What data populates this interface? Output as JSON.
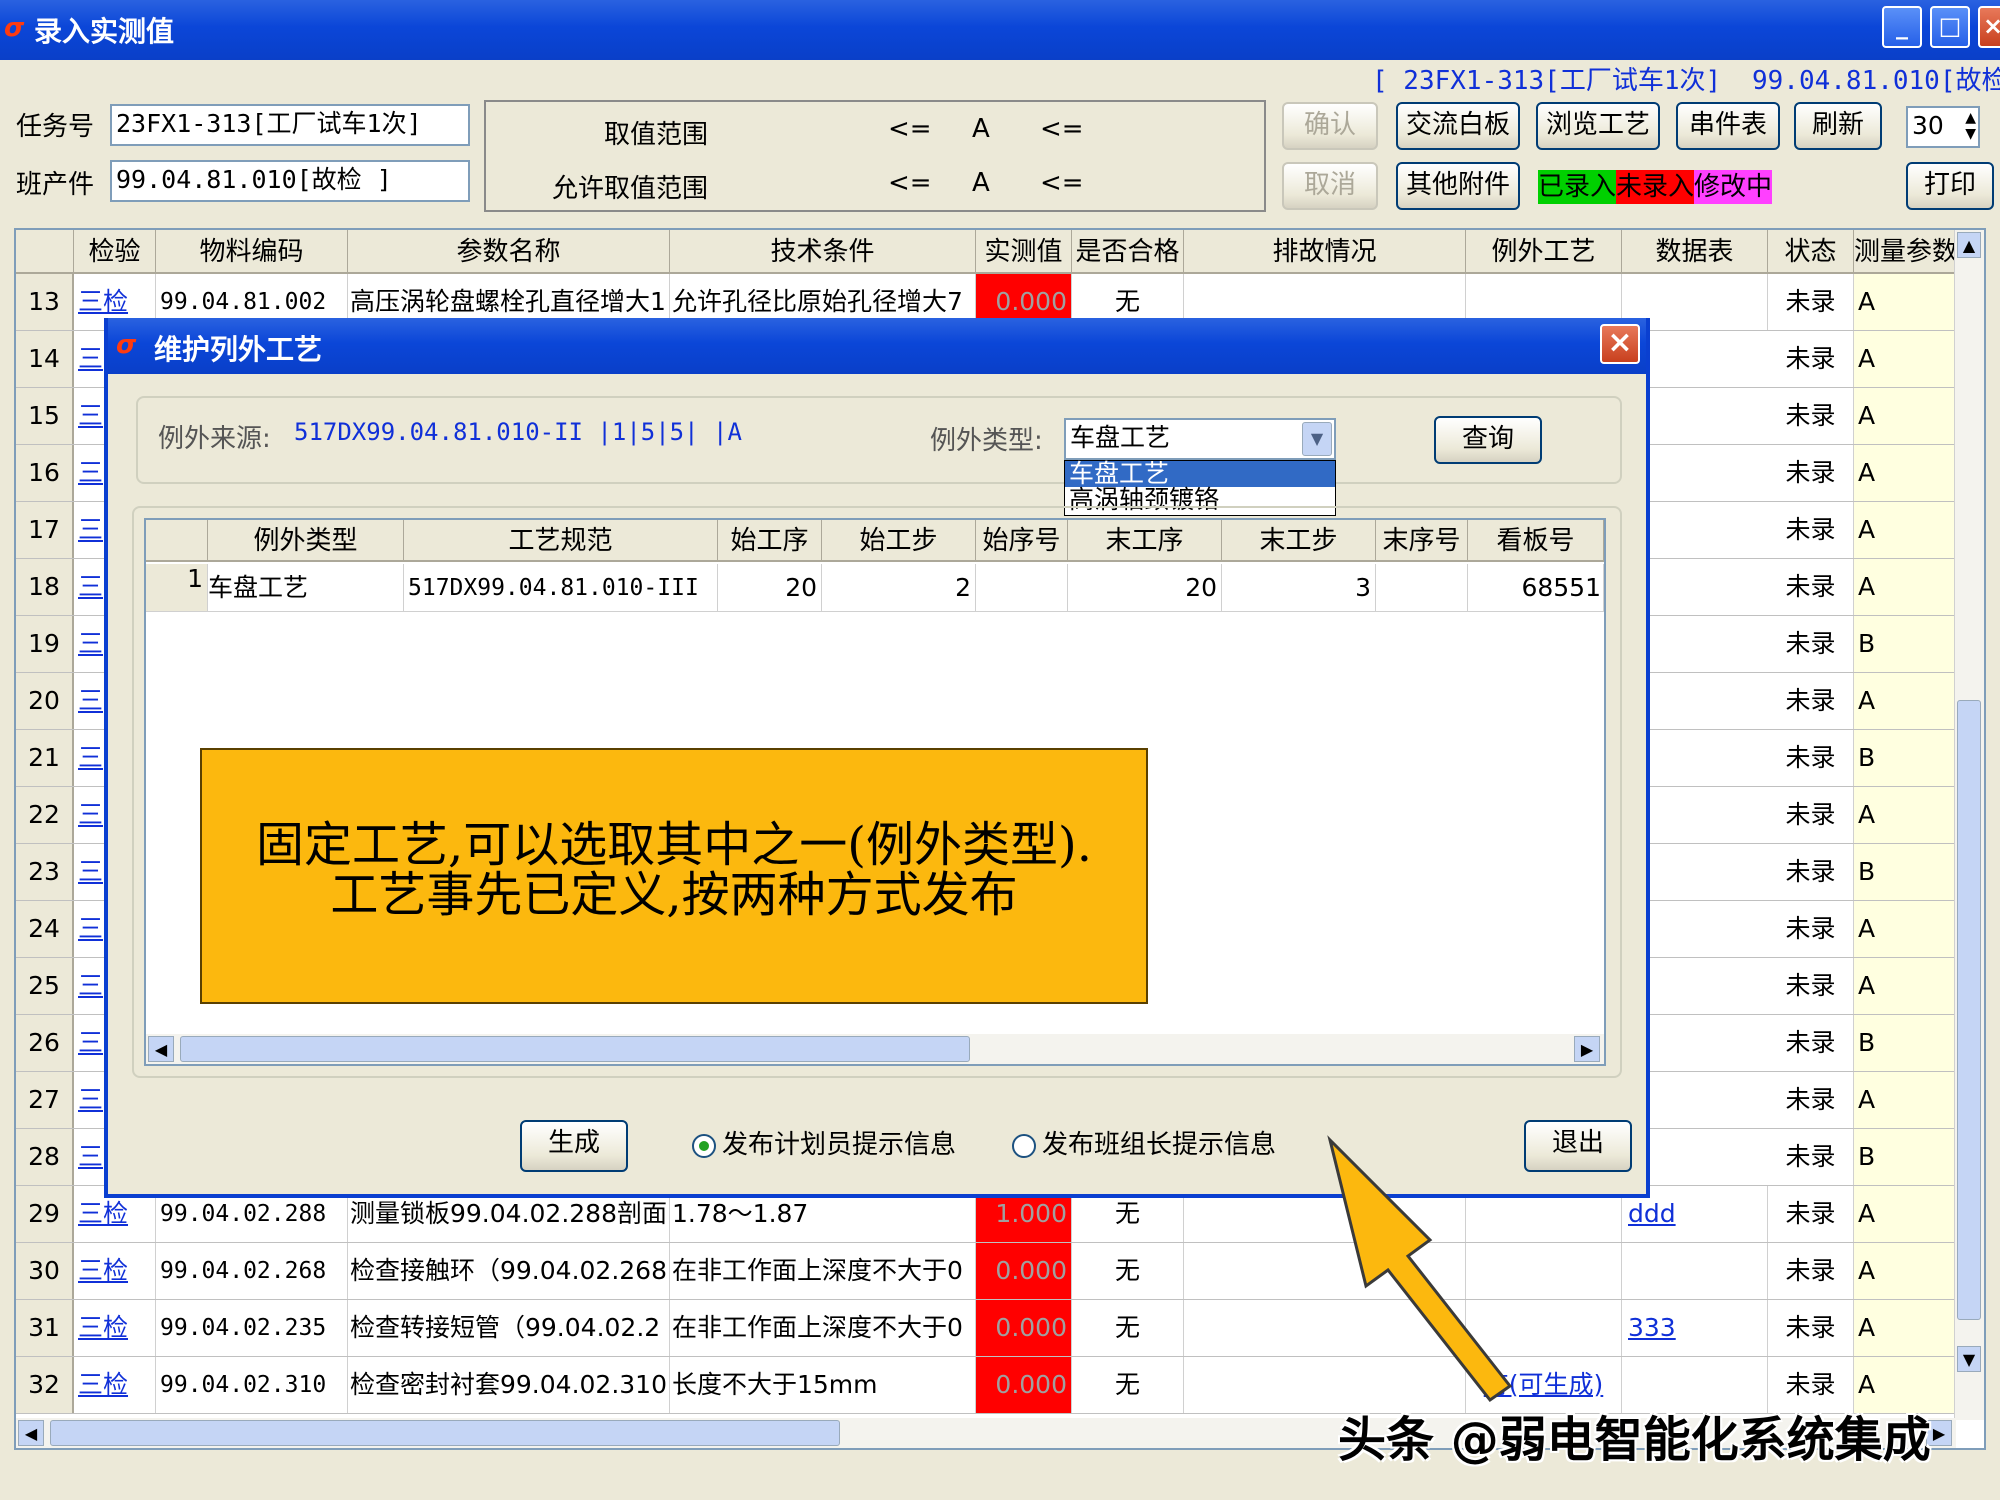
{
  "window": {
    "title": "录入实测值"
  },
  "header_info": {
    "task_ref": "[ 23FX1-313[工厂试车1次]",
    "part_ref": "99.04.81.010[故检"
  },
  "task": {
    "label": "任务号",
    "value": "23FX1-313[工厂试车1次]"
  },
  "part": {
    "label": "班产件",
    "value": "99.04.81.010[故检 ]"
  },
  "range": {
    "label1": "取值范围",
    "label2": "允许取值范围",
    "le": "<=",
    "a": "A"
  },
  "buttons": {
    "confirm": "确认",
    "cancel": "取消",
    "whiteboard": "交流白板",
    "browse": "浏览工艺",
    "parts_list": "串件表",
    "refresh": "刷新",
    "attachments": "其他附件",
    "print": "打印"
  },
  "page_size": "30",
  "legend": {
    "entered": "已录入",
    "not_entered": "未录入",
    "modifying": "修改中",
    "entered_color": "#00d000",
    "not_entered_color": "#ff0000",
    "modifying_color": "#ff40ff"
  },
  "grid": {
    "headers": [
      "检验",
      "物料编码",
      "参数名称",
      "技术条件",
      "实测值",
      "是否合格",
      "排故情况",
      "例外工艺",
      "数据表",
      "状态",
      "测量参数"
    ],
    "rows": [
      {
        "no": "13",
        "check": "三检",
        "code": "99.04.81.002",
        "name": "高压涡轮盘螺栓孔直径增大1",
        "cond": "允许孔径比原始孔径增大7",
        "value": "0.000",
        "ok": "无",
        "exc": "",
        "table": "",
        "status": "未录",
        "param": "A"
      },
      {
        "no": "14",
        "check": "三",
        "status": "未录",
        "param": "A"
      },
      {
        "no": "15",
        "check": "三",
        "status": "未录",
        "param": "A"
      },
      {
        "no": "16",
        "check": "三",
        "status": "未录",
        "param": "A"
      },
      {
        "no": "17",
        "check": "三",
        "status": "未录",
        "param": "A"
      },
      {
        "no": "18",
        "check": "三",
        "status": "未录",
        "param": "A"
      },
      {
        "no": "19",
        "check": "三",
        "status": "未录",
        "param": "B"
      },
      {
        "no": "20",
        "check": "三",
        "status": "未录",
        "param": "A"
      },
      {
        "no": "21",
        "check": "三",
        "status": "未录",
        "param": "B"
      },
      {
        "no": "22",
        "check": "三",
        "status": "未录",
        "param": "A"
      },
      {
        "no": "23",
        "check": "三",
        "status": "未录",
        "param": "B"
      },
      {
        "no": "24",
        "check": "三",
        "status": "未录",
        "param": "A"
      },
      {
        "no": "25",
        "check": "三",
        "status": "未录",
        "param": "A"
      },
      {
        "no": "26",
        "check": "三",
        "status": "未录",
        "param": "B"
      },
      {
        "no": "27",
        "check": "三",
        "status": "未录",
        "param": "A"
      },
      {
        "no": "28",
        "check": "三",
        "status": "未录",
        "param": "B"
      },
      {
        "no": "29",
        "check": "三检",
        "code": "99.04.02.288",
        "name": "测量锁板99.04.02.288剖面",
        "cond": "1.78～1.87",
        "value": "1.000",
        "ok": "无",
        "exc": "",
        "table": "ddd",
        "status": "未录",
        "param": "A"
      },
      {
        "no": "30",
        "check": "三检",
        "code": "99.04.02.268",
        "name": "检查接触环（99.04.02.268",
        "cond": "在非工作面上深度不大于0",
        "value": "0.000",
        "ok": "无",
        "exc": "",
        "table": "",
        "status": "未录",
        "param": "A"
      },
      {
        "no": "31",
        "check": "三检",
        "code": "99.04.02.235",
        "name": "检查转接短管（99.04.02.2",
        "cond": "在非工作面上深度不大于0",
        "value": "0.000",
        "ok": "无",
        "exc": "",
        "table": "333",
        "status": "未录",
        "param": "A"
      },
      {
        "no": "32",
        "check": "三检",
        "code": "99.04.02.310",
        "name": "检查密封衬套99.04.02.310",
        "cond": "长度不大于15mm",
        "value": "0.000",
        "ok": "无",
        "exc": "有(可生成)",
        "table": "",
        "status": "未录",
        "param": "A"
      }
    ]
  },
  "dialog": {
    "title": "维护列外工艺",
    "source_label": "例外来源:",
    "source_value": "517DX99.04.81.010-II |1|5|5| |A",
    "type_label": "例外类型:",
    "type_value": "车盘工艺",
    "type_options": [
      "车盘工艺",
      "高涡轴颈镀铬"
    ],
    "query": "查询",
    "table_headers": [
      "例外类型",
      "工艺规范",
      "始工序",
      "始工步",
      "始序号",
      "末工序",
      "末工步",
      "末序号",
      "看板号"
    ],
    "table_row": {
      "no": "1",
      "type": "车盘工艺",
      "spec": "517DX99.04.81.010-III",
      "start_proc": "20",
      "start_step": "2",
      "start_seq": "",
      "end_proc": "20",
      "end_step": "3",
      "end_seq": "",
      "board": "68551"
    },
    "note_line1": "固定工艺,可以选取其中之一(例外类型).",
    "note_line2": "工艺事先已定义,按两种方式发布",
    "generate": "生成",
    "radio1": "发布计划员提示信息",
    "radio2": "发布班组长提示信息",
    "exit": "退出"
  },
  "watermark": "头条 @弱电智能化系统集成"
}
